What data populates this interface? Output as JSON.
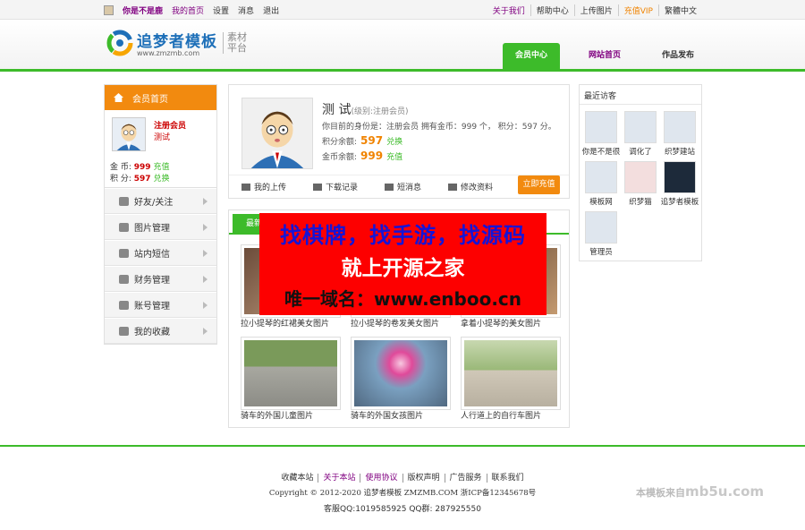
{
  "topbar": {
    "username": "你是不是鹿",
    "links": [
      "我的首页",
      "设置",
      "消息",
      "退出"
    ],
    "right_links": [
      "关于我们",
      "帮助中心",
      "上传图片",
      "充值VIP",
      "繁體中文"
    ]
  },
  "logo": {
    "name": "追梦者模板",
    "url": "www.zmzmb.com",
    "sub1": "素材",
    "sub2": "平台"
  },
  "nav": [
    "会员中心",
    "网站首页",
    "作品发布"
  ],
  "sidebar": {
    "head": "会员首页",
    "role": "注册会员",
    "name": "测试",
    "coin_label": "金 币:",
    "coin_value": "999",
    "coin_link": "充值",
    "points_label": "积 分:",
    "points_value": "597",
    "points_link": "兑换",
    "items": [
      "好友/关注",
      "图片管理",
      "站内短信",
      "财务管理",
      "账号管理",
      "我的收藏"
    ]
  },
  "profile": {
    "name": "测 试",
    "level": "(级别:注册会员)",
    "desc": "你目前的身份是：注册会员 拥有金币：999 个， 积分：597 分。",
    "points_label": "积分余额:",
    "points_value": "597",
    "points_link": "兑换",
    "gold_label": "金币余额:",
    "gold_value": "999",
    "gold_link": "充值",
    "actions": [
      "我的上传",
      "下载记录",
      "短消息",
      "修改资料"
    ],
    "button": "立即充值"
  },
  "works": {
    "tab": "最新",
    "captions": [
      "拉小提琴的红裙美女图片",
      "拉小提琴的卷发美女图片",
      "拿着小提琴的美女图片",
      "骑车的外国儿童图片",
      "骑车的外国女孩图片",
      "人行道上的自行车图片"
    ]
  },
  "visitors": {
    "title": "最近访客",
    "names": [
      "你是不是很",
      "调化了",
      "织梦建站",
      "模板网",
      "织梦猫",
      "追梦者模板",
      "管理员"
    ]
  },
  "ad": {
    "line1": "找棋牌，找手游，找源码",
    "line2": "就上开源之家",
    "line3": "唯一域名：www.enboo.cn"
  },
  "footer": {
    "links": [
      "收藏本站",
      "关于本站",
      "使用协议",
      "版权声明",
      "广告服务",
      "联系我们"
    ],
    "copyright": "Copyright © 2012-2020 追梦者模板 ZMZMB.COM 浙ICP备12345678号",
    "qq": "客服QQ:1019585925 QQ群: 287925550",
    "watermark_prefix": "本模板来自",
    "watermark": "mb5u.com"
  },
  "colors": {
    "green": "#3dbb2a",
    "orange": "#f28a0f",
    "purple": "#800080",
    "red_ad": "#fd0000"
  }
}
